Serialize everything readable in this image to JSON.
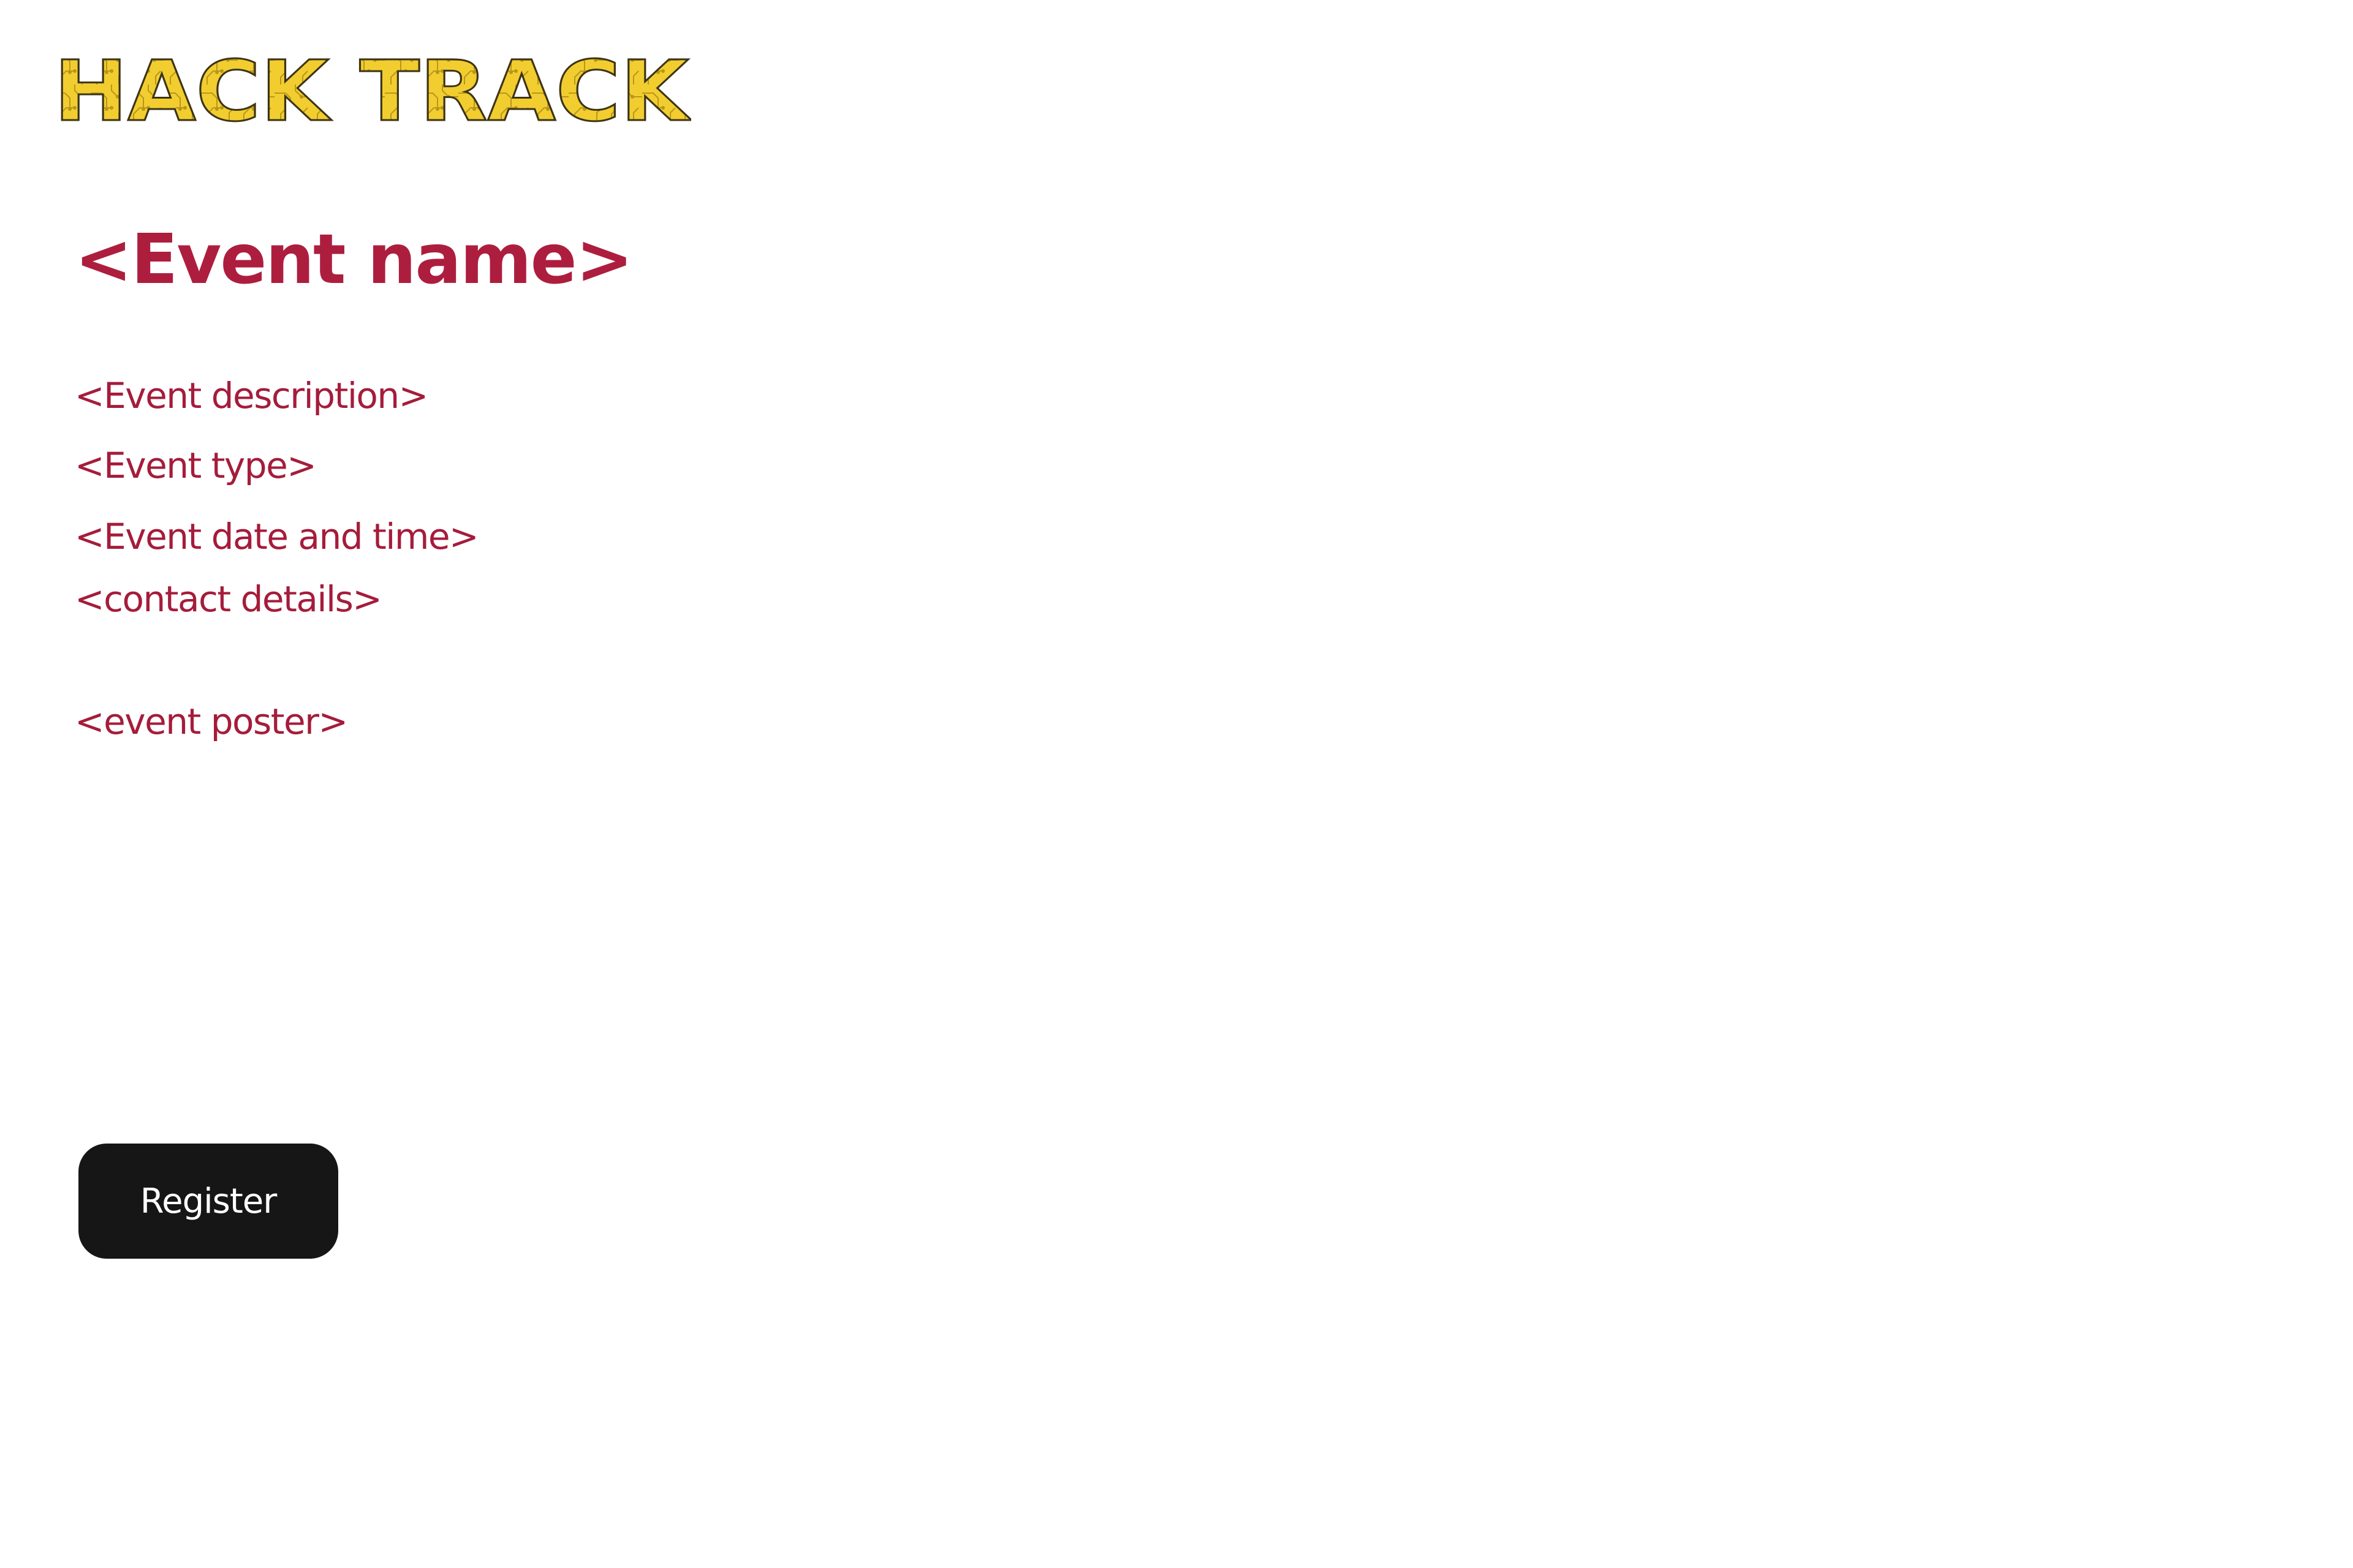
{
  "header": {
    "logo_text": "HACK TRACK"
  },
  "event": {
    "name": "<Event name>",
    "description": "<Event description>",
    "type": "<Event type>",
    "date_time": "<Event date and time>",
    "contact": "<contact details>",
    "poster": "<event poster>"
  },
  "actions": {
    "register_label": "Register"
  },
  "colors": {
    "accent": "#ad1e3e",
    "logo_fill": "#f2cd2f",
    "logo_outline": "#3c3414",
    "button_bg": "#161616",
    "button_text": "#ffffff",
    "background": "#ffffff"
  },
  "icons": {
    "logo": "hack-track-logo-icon"
  }
}
